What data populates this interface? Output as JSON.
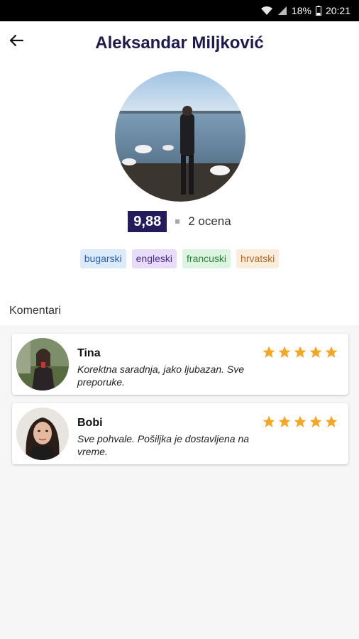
{
  "status_bar": {
    "battery": "18%",
    "time": "20:21"
  },
  "header": {
    "title": "Aleksandar Miljković"
  },
  "profile": {
    "rating": "9,88",
    "rating_count": "2 ocena",
    "languages": [
      "bugarski",
      "engleski",
      "francuski",
      "hrvatski"
    ]
  },
  "comments": {
    "label": "Komentari",
    "items": [
      {
        "name": "Tina",
        "text": "Korektna saradnja, jako ljubazan. Sve preporuke.",
        "stars": 5
      },
      {
        "name": "Bobi",
        "text": "Sve pohvale. Pošiljka je dostavljena na vreme.",
        "stars": 5
      }
    ]
  },
  "colors": {
    "title": "#1f1a4e",
    "rating_badge": "#241b5c",
    "star": "#f5a623"
  }
}
